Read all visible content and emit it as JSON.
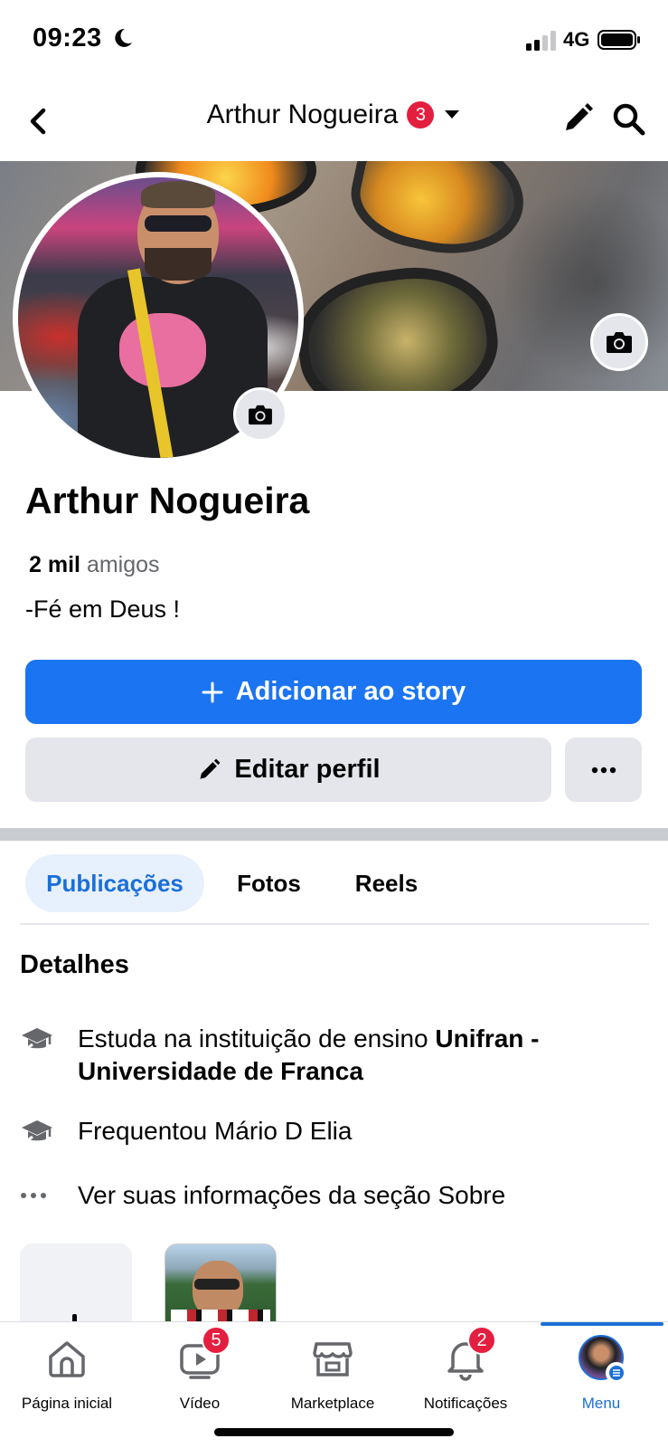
{
  "status_bar": {
    "time": "09:23",
    "network": "4G"
  },
  "header": {
    "title": "Arthur Nogueira",
    "badge": "3"
  },
  "profile": {
    "name": "Arthur Nogueira",
    "friends_count": "2 mil",
    "friends_label": "amigos",
    "bio": "-Fé em Deus !"
  },
  "buttons": {
    "add_story": "Adicionar ao story",
    "edit_profile": "Editar perfil"
  },
  "tabs": [
    "Publicações",
    "Fotos",
    "Reels"
  ],
  "active_tab": "Publicações",
  "details": {
    "title": "Detalhes",
    "items": [
      {
        "icon": "graduation-cap-icon",
        "prefix": "Estuda na instituição de ensino ",
        "bold": "Unifran - Universidade de Franca"
      },
      {
        "icon": "graduation-cap-icon",
        "text": "Frequentou Mário D Elia"
      },
      {
        "icon": "ellipsis-icon",
        "text": "Ver suas informações da seção Sobre"
      }
    ]
  },
  "bottom_nav": {
    "items": [
      {
        "label": "Página inicial",
        "icon": "home-icon"
      },
      {
        "label": "Vídeo",
        "icon": "video-icon",
        "badge": "5"
      },
      {
        "label": "Marketplace",
        "icon": "marketplace-icon"
      },
      {
        "label": "Notificações",
        "icon": "bell-icon",
        "badge": "2"
      },
      {
        "label": "Menu",
        "icon": "menu-avatar"
      }
    ],
    "active": "Menu"
  },
  "colors": {
    "primary": "#1b74f2",
    "active_tab_bg": "#e7f0fd",
    "active_text": "#1b6fd8",
    "button_gray": "#e4e6eb",
    "badge_red": "#e41e3f"
  }
}
